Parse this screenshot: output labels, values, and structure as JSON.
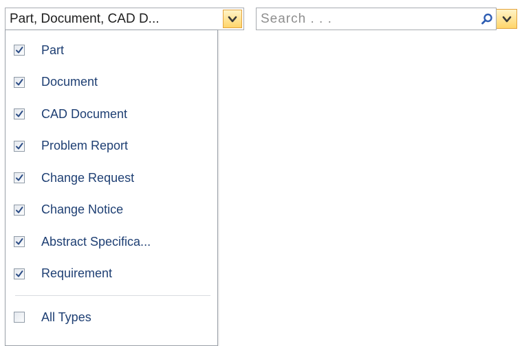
{
  "type_selector": {
    "value": "Part, Document, CAD D...",
    "arrow_icon": "chevron-down-icon"
  },
  "search": {
    "placeholder": "Search . . .",
    "value": "",
    "search_icon": "magnifier-icon",
    "options_icon": "chevron-down-icon"
  },
  "type_list": {
    "items": [
      {
        "label": "Part",
        "checked": true
      },
      {
        "label": "Document",
        "checked": true
      },
      {
        "label": "CAD Document",
        "checked": true
      },
      {
        "label": "Problem Report",
        "checked": true
      },
      {
        "label": "Change Request",
        "checked": true
      },
      {
        "label": "Change Notice",
        "checked": true
      },
      {
        "label": "Abstract Specifica...",
        "checked": true
      },
      {
        "label": "Requirement",
        "checked": true
      }
    ],
    "all_types": {
      "label": "All Types",
      "checked": false
    }
  },
  "colors": {
    "label_text": "#1e3f73",
    "accent_orange": "#e3a33d",
    "accent_fill": "#ffd56a",
    "check_mark": "#2c4d86",
    "border": "#a7abb0"
  }
}
